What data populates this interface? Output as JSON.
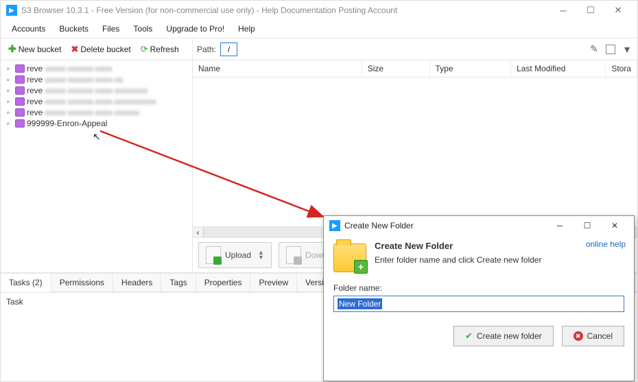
{
  "titlebar": {
    "title": "S3 Browser 10.3.1 - Free Version (for non-commercial use only) - Help Documentation Posting Account"
  },
  "menu": {
    "accounts": "Accounts",
    "buckets": "Buckets",
    "files": "Files",
    "tools": "Tools",
    "upgrade": "Upgrade to Pro!",
    "help": "Help"
  },
  "toolbar": {
    "new_bucket": "New bucket",
    "delete_bucket": "Delete bucket",
    "refresh": "Refresh",
    "path_label": "Path:",
    "path_value": "/"
  },
  "tree": {
    "items": [
      {
        "prefix": "reve",
        "rest": ""
      },
      {
        "prefix": "reve",
        "rest": ""
      },
      {
        "prefix": "reve",
        "rest": ""
      },
      {
        "prefix": "reve",
        "rest": ""
      },
      {
        "prefix": "reve",
        "rest": ""
      },
      {
        "prefix": "999999-Enron-Appeal",
        "rest": ""
      }
    ]
  },
  "columns": {
    "name": "Name",
    "size": "Size",
    "type": "Type",
    "modified": "Last Modified",
    "storage": "Stora"
  },
  "bottom_toolbar": {
    "upload": "Upload",
    "download": "Downlo"
  },
  "tabs": {
    "tasks": "Tasks (2)",
    "permissions": "Permissions",
    "headers": "Headers",
    "tags": "Tags",
    "properties": "Properties",
    "preview": "Preview",
    "versions": "Versions"
  },
  "task_panel": {
    "task_col": "Task"
  },
  "dialog": {
    "title": "Create New Folder",
    "heading": "Create New Folder",
    "subtext": "Enter folder name and click Create new folder",
    "online_help": "online help",
    "field_label": "Folder name:",
    "input_value": "New Folder",
    "create_btn": "Create new folder",
    "cancel_btn": "Cancel"
  }
}
